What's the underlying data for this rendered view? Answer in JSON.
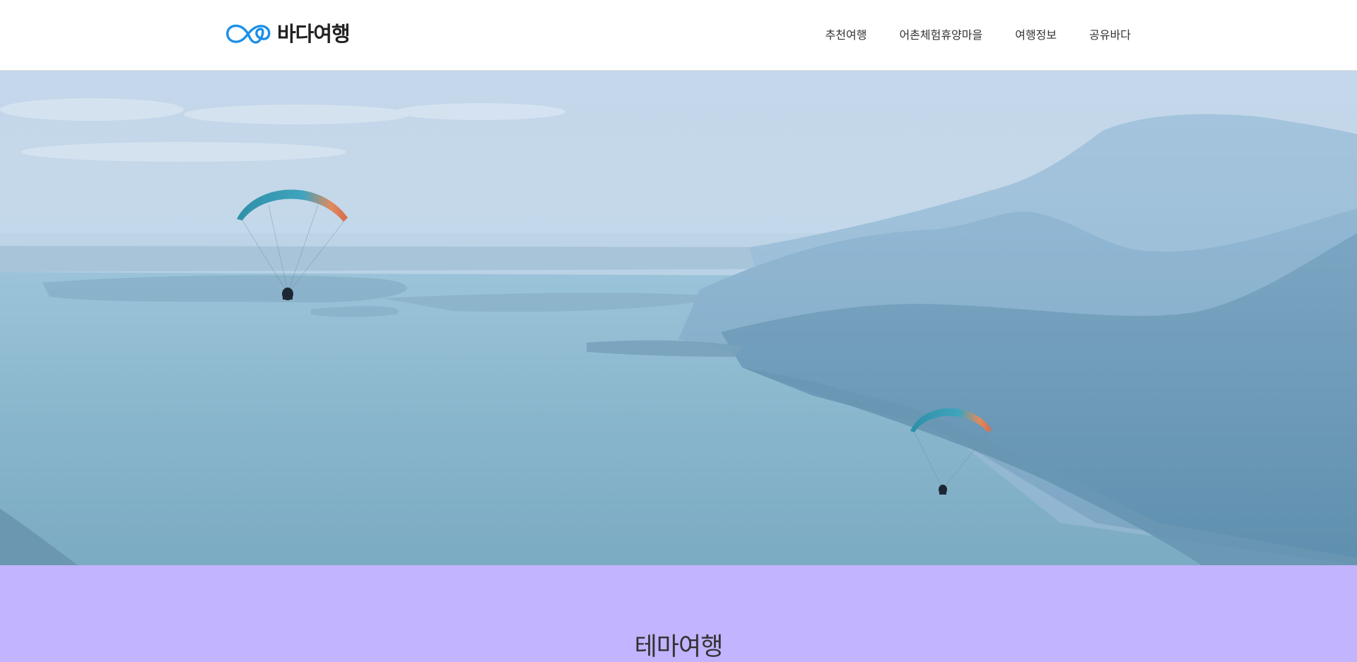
{
  "brand": {
    "name": "바다여행",
    "color": "#1a8fe8"
  },
  "nav": {
    "items": [
      {
        "label": "추천여행"
      },
      {
        "label": "어촌체험휴양마을"
      },
      {
        "label": "여행정보"
      },
      {
        "label": "공유바다"
      }
    ]
  },
  "hero": {
    "icon": "hero-landscape-image"
  },
  "theme": {
    "title": "테마여행",
    "background": "#c2b4fe"
  }
}
